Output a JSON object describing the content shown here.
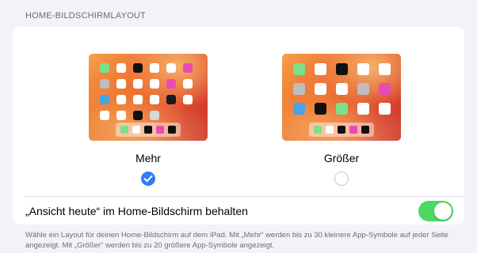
{
  "section_header": "HOME-BILDSCHIRMLAYOUT",
  "options": [
    {
      "label": "Mehr",
      "selected": true,
      "apps": [
        "#7be08a",
        "#ffffff",
        "#111111",
        "#ffffff",
        "#ffffff",
        "#e94bb3",
        "#bdbdbd",
        "#ffffff",
        "#ffffff",
        "#ffffff",
        "#e94bb3",
        "#ffffff",
        "#4aa3e8",
        "#ffffff",
        "#ffffff",
        "#ffffff",
        "#1a1a1a",
        "#ffffff",
        "#ffffff",
        "#ffffff",
        "#111111",
        "#d8d8d8"
      ],
      "dock": [
        "#7be08a",
        "#ffffff",
        "#111111",
        "#e94bb3",
        "#111111"
      ]
    },
    {
      "label": "Größer",
      "selected": false,
      "apps": [
        "#7be08a",
        "#ffffff",
        "#111111",
        "#ffffff",
        "#ffffff",
        "#bdbdbd",
        "#ffffff",
        "#ffffff",
        "#bdbdbd",
        "#e94bb3",
        "#4aa3e8",
        "#111111",
        "#7be08a",
        "#ffffff",
        "#ffffff"
      ],
      "dock": [
        "#7be08a",
        "#ffffff",
        "#111111",
        "#e94bb3",
        "#111111"
      ]
    }
  ],
  "today_view_label": "„Ansicht heute“ im Home-Bildschirm behalten",
  "today_view_enabled": true,
  "footer": "Wähle ein Layout für deinen Home-Bildschirm auf dem iPad. Mit „Mehr“ werden bis zu 30 kleinere App-Symbole auf jeder Seite angezeigt. Mit „Größer“ werden bis zu 20 größere App-Symbole angezeigt.",
  "colors": {
    "accent": "#2f7cf6",
    "toggle_on": "#4cd964"
  }
}
